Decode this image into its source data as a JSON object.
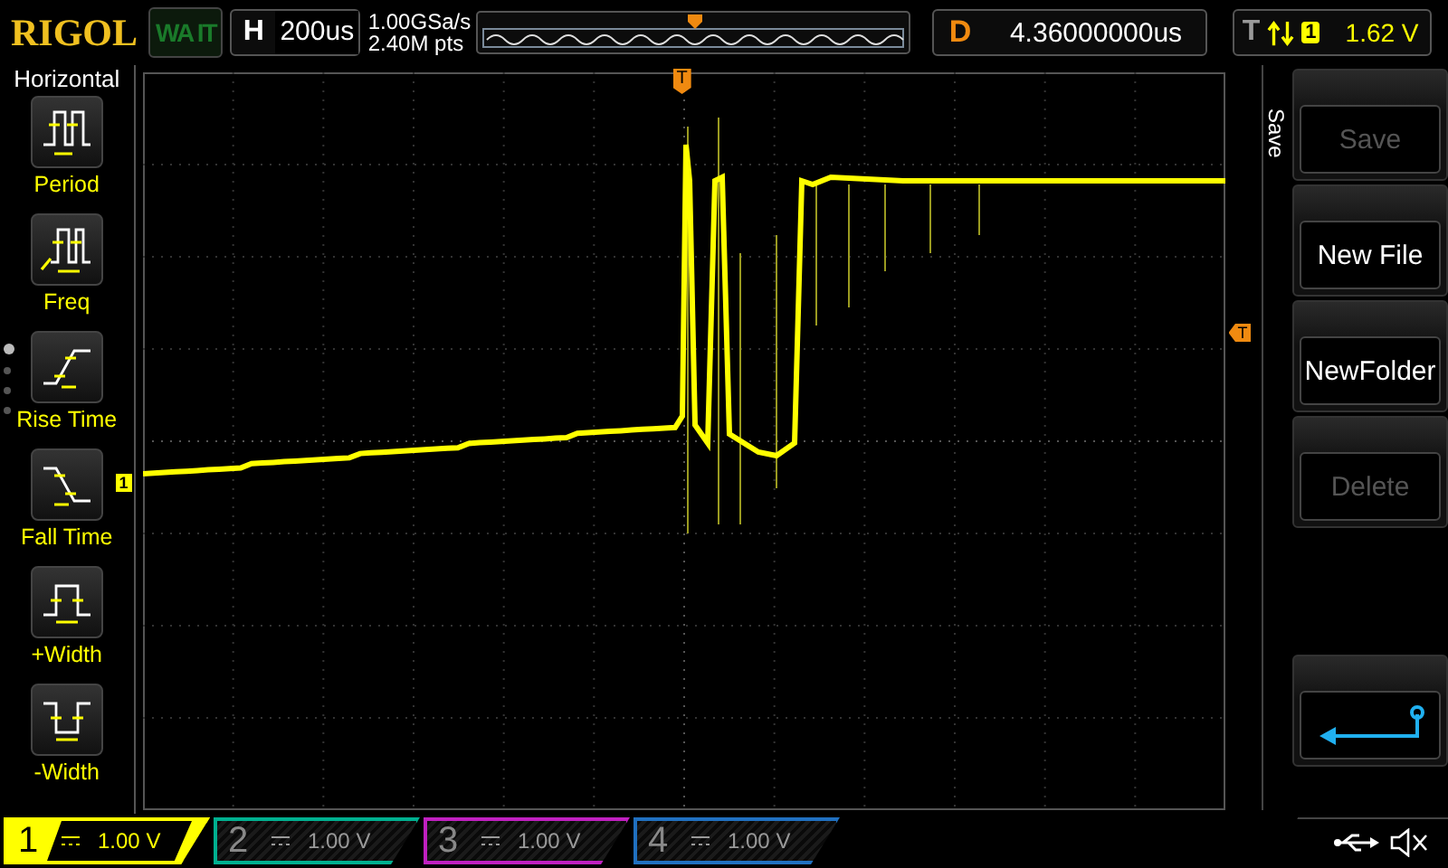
{
  "header": {
    "logo": "RIGOL",
    "status": "WA IT",
    "timebase": {
      "label": "H",
      "value": "200us"
    },
    "sample_rate": "1.00GSa/s",
    "memory_depth": "2.40M pts",
    "delay": {
      "label": "D",
      "value": "4.36000000us"
    },
    "trigger": {
      "label": "T",
      "source": "1",
      "level": "1.62 V"
    }
  },
  "sidebar": {
    "title": "Horizontal",
    "items": [
      {
        "kind": "period",
        "label": "Period"
      },
      {
        "kind": "freq",
        "label": "Freq"
      },
      {
        "kind": "rise",
        "label": "Rise Time"
      },
      {
        "kind": "fall",
        "label": "Fall Time"
      },
      {
        "kind": "pwidth",
        "label": "+Width"
      },
      {
        "kind": "nwidth",
        "label": "-Width"
      }
    ],
    "pages": [
      {
        "selected": true
      },
      {
        "selected": false
      },
      {
        "selected": false
      },
      {
        "selected": false
      }
    ]
  },
  "markers": {
    "trigger_position": "T",
    "trigger_level": "T",
    "channel": "1"
  },
  "menu": {
    "title": "Save",
    "buttons": [
      {
        "kind": "text",
        "label": "Save",
        "disabled": true
      },
      {
        "kind": "text",
        "label": "New File",
        "disabled": false
      },
      {
        "kind": "text",
        "label": "NewFolder",
        "disabled": false
      },
      {
        "kind": "text",
        "label": "Delete",
        "disabled": true
      },
      {
        "kind": "spacer"
      },
      {
        "kind": "back"
      }
    ]
  },
  "channels": [
    {
      "number": "1",
      "scale": "1.00 V",
      "selected": true,
      "color": "#ffff00"
    },
    {
      "number": "2",
      "scale": "1.00 V",
      "selected": false,
      "color": "#00b090"
    },
    {
      "number": "3",
      "scale": "1.00 V",
      "selected": false,
      "color": "#c020c0"
    },
    {
      "number": "4",
      "scale": "1.00 V",
      "selected": false,
      "color": "#2070c0"
    }
  ]
}
